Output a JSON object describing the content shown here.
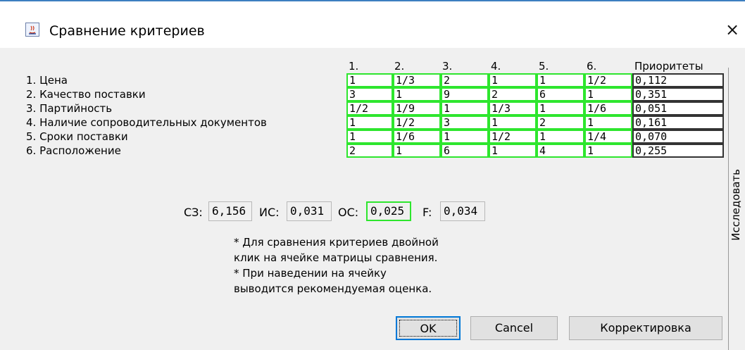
{
  "window": {
    "title": "Сравнение критериев",
    "close_glyph": "×"
  },
  "matrix": {
    "columns": [
      "1.",
      "2.",
      "3.",
      "4.",
      "5.",
      "6."
    ],
    "priority_header": "Приоритеты",
    "rows": [
      {
        "label": "1. Цена",
        "cells": [
          "1",
          "1/3",
          "2",
          "1",
          "1",
          "1/2"
        ],
        "priority": "0,112"
      },
      {
        "label": "2. Качество поставки",
        "cells": [
          "3",
          "1",
          "9",
          "2",
          "6",
          "1"
        ],
        "priority": "0,351"
      },
      {
        "label": "3. Партийность",
        "cells": [
          "1/2",
          "1/9",
          "1",
          "1/3",
          "1",
          "1/6"
        ],
        "priority": "0,051"
      },
      {
        "label": "4. Наличие сопроводительных документов",
        "cells": [
          "1",
          "1/2",
          "3",
          "1",
          "2",
          "1"
        ],
        "priority": "0,161"
      },
      {
        "label": "5. Сроки поставки",
        "cells": [
          "1",
          "1/6",
          "1",
          "1/2",
          "1",
          "1/4"
        ],
        "priority": "0,070"
      },
      {
        "label": "6. Расположение",
        "cells": [
          "2",
          "1",
          "6",
          "1",
          "4",
          "1"
        ],
        "priority": "0,255"
      }
    ]
  },
  "stats": {
    "sz_label": "СЗ:",
    "sz_value": "6,156",
    "is_label": "ИС:",
    "is_value": "0,031",
    "os_label": "ОС:",
    "os_value": "0,025",
    "f_label": "F:",
    "f_value": "0,034"
  },
  "notes": [
    "* Для сравнения критериев двойной",
    "клик на ячейке матрицы сравнения.",
    "* При наведении на ячейку",
    "выводится рекомендуемая оценка."
  ],
  "buttons": {
    "ok": "OK",
    "cancel": "Cancel",
    "correct": "Корректировка"
  },
  "side_panel": {
    "label": "Исследовать"
  },
  "colors": {
    "cell_border": "#2ee62e",
    "priority_border": "#333333",
    "accent": "#0078d7"
  }
}
